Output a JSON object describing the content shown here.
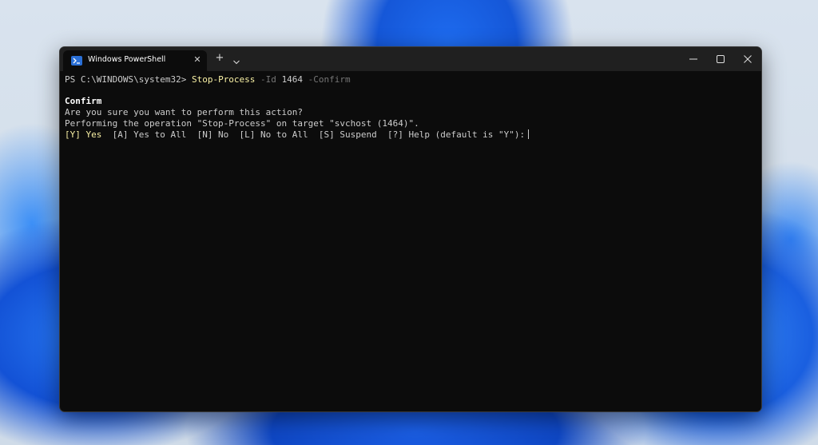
{
  "window": {
    "tab_title": "Windows PowerShell",
    "tab_close_glyph": "✕",
    "new_tab_glyph": "+",
    "accent": "#2a6fd6",
    "terminal_bg": "#0c0c0c"
  },
  "terminal": {
    "prompt": "PS C:\\WINDOWS\\system32> ",
    "command": "Stop-Process",
    "param1": " -Id ",
    "arg1": "1464",
    "param2": " -Confirm",
    "confirm_heading": "Confirm",
    "question": "Are you sure you want to perform this action?",
    "operation": "Performing the operation \"Stop-Process\" on target \"svchost (1464)\".",
    "option_yes": "[Y] Yes",
    "options_rest": "  [A] Yes to All  [N] No  [L] No to All  [S] Suspend  [?] Help (default is \"Y\"):",
    "colors": {
      "command": "#f9f1a5",
      "parameter": "#767676",
      "text": "#cccccc"
    }
  },
  "icons": {
    "tab": "powershell-icon",
    "dropdown": "chevron-down-icon",
    "minimize": "minimize-icon",
    "maximize": "maximize-icon",
    "close": "close-icon"
  }
}
